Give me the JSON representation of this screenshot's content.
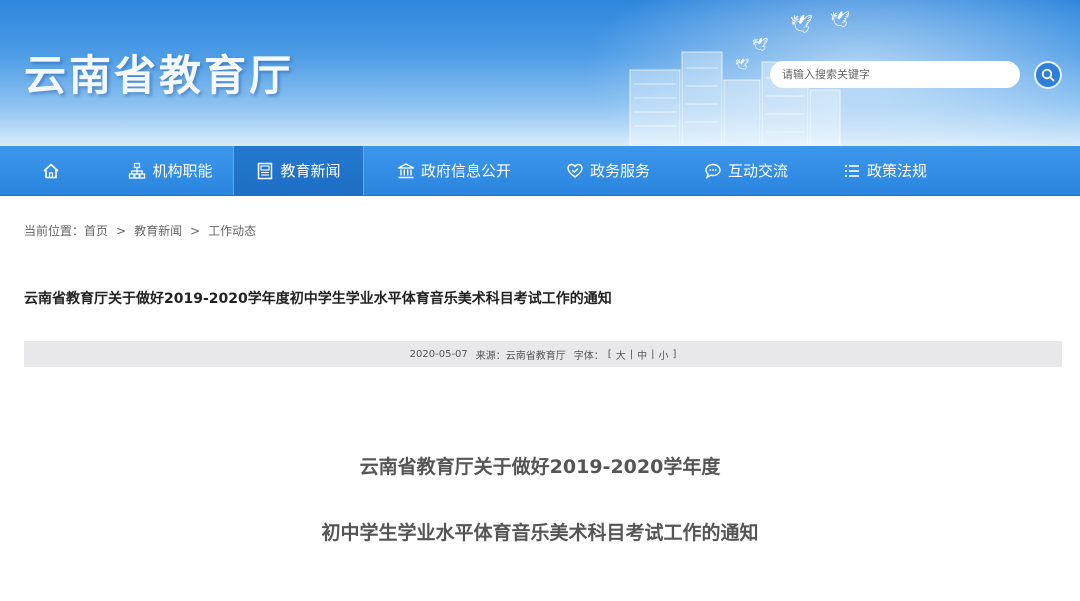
{
  "header": {
    "site_title": "云南省教育厅",
    "search_placeholder": "请输入搜索关键字"
  },
  "nav": {
    "items": [
      {
        "label": "",
        "icon": "home-icon"
      },
      {
        "label": "机构职能",
        "icon": "org-chart-icon"
      },
      {
        "label": "教育新闻",
        "icon": "document-icon",
        "active": true
      },
      {
        "label": "政府信息公开",
        "icon": "bank-icon"
      },
      {
        "label": "政务服务",
        "icon": "heart-hands-icon"
      },
      {
        "label": "互动交流",
        "icon": "chat-bubble-icon"
      },
      {
        "label": "政策法规",
        "icon": "list-icon"
      }
    ]
  },
  "breadcrumb": {
    "prefix": "当前位置：",
    "home": "首页",
    "sep": ">",
    "section": "教育新闻",
    "current": "工作动态"
  },
  "article": {
    "title": "云南省教育厅关于做好2019-2020学年度初中学生学业水平体育音乐美术科目考试工作的通知",
    "date": "2020-05-07",
    "source_label": "来源：",
    "source": "云南省教育厅",
    "font_label": "字体：",
    "font_open": "[",
    "font_large": "大",
    "font_medium": "中",
    "font_small": "小",
    "font_close": "]",
    "font_sep": "|",
    "heading_line1": "云南省教育厅关于做好2019-2020学年度",
    "heading_line2": "初中学生学业水平体育音乐美术科目考试工作的通知"
  },
  "colors": {
    "nav_bg": "#2b85de",
    "nav_active": "#1d6ec4",
    "meta_bar": "#e8e7e9"
  }
}
